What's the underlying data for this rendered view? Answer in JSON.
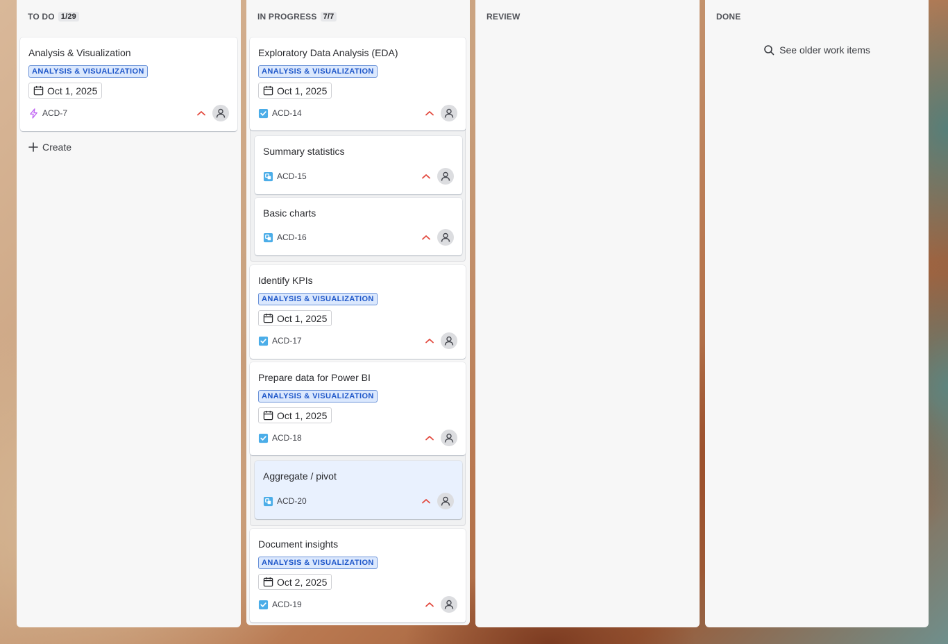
{
  "columns": {
    "todo": {
      "title": "TO DO",
      "count": "1/29",
      "create_label": "Create"
    },
    "in_progress": {
      "title": "IN PROGRESS",
      "count": "7/7"
    },
    "review": {
      "title": "REVIEW"
    },
    "done": {
      "title": "DONE",
      "older_label": "See older work items"
    }
  },
  "cards": {
    "acd7": {
      "title": "Analysis & Visualization",
      "label": "ANALYSIS & VISUALIZATION",
      "date": "Oct 1, 2025",
      "key": "ACD-7",
      "type_icon": "epic-icon"
    },
    "acd14": {
      "title": "Exploratory Data Analysis (EDA)",
      "label": "ANALYSIS & VISUALIZATION",
      "date": "Oct 1, 2025",
      "key": "ACD-14",
      "type_icon": "task-icon"
    },
    "acd15": {
      "title": "Summary statistics",
      "key": "ACD-15",
      "type_icon": "subtask-icon"
    },
    "acd16": {
      "title": "Basic charts",
      "key": "ACD-16",
      "type_icon": "subtask-icon"
    },
    "acd17": {
      "title": "Identify KPIs",
      "label": "ANALYSIS & VISUALIZATION",
      "date": "Oct 1, 2025",
      "key": "ACD-17",
      "type_icon": "task-icon"
    },
    "acd18": {
      "title": "Prepare data for Power BI",
      "label": "ANALYSIS & VISUALIZATION",
      "date": "Oct 1, 2025",
      "key": "ACD-18",
      "type_icon": "task-icon"
    },
    "acd20": {
      "title": "Aggregate / pivot",
      "key": "ACD-20",
      "type_icon": "subtask-icon"
    },
    "acd19": {
      "title": "Document insights",
      "label": "ANALYSIS & VISUALIZATION",
      "date": "Oct 2, 2025",
      "key": "ACD-19",
      "type_icon": "task-icon"
    }
  },
  "colors": {
    "priority": "#e2483d",
    "label_bg": "#dbe8fd",
    "label_text": "#1d56c9",
    "task_icon": "#4bade8",
    "epic_icon": "#bf63f3"
  }
}
